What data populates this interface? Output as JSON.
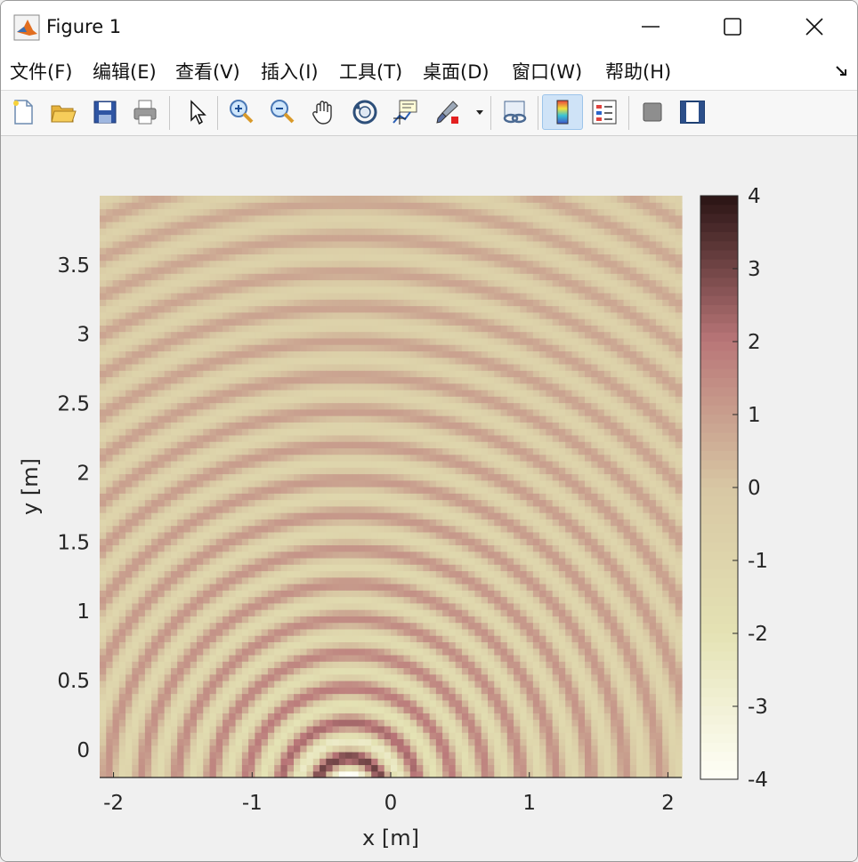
{
  "window": {
    "title": "Figure 1"
  },
  "menu": {
    "items": [
      "文件(F)",
      "编辑(E)",
      "查看(V)",
      "插入(I)",
      "工具(T)",
      "桌面(D)",
      "窗口(W)",
      "帮助(H)"
    ]
  },
  "toolbar": {
    "buttons": [
      {
        "icon": "new-figure-icon"
      },
      {
        "icon": "open-file-icon"
      },
      {
        "icon": "save-icon"
      },
      {
        "icon": "print-icon"
      },
      {
        "icon": "select-pointer-icon"
      },
      {
        "icon": "zoom-in-icon"
      },
      {
        "icon": "zoom-out-icon"
      },
      {
        "icon": "pan-hand-icon"
      },
      {
        "icon": "rotate-3d-icon"
      },
      {
        "icon": "data-cursor-icon"
      },
      {
        "icon": "brush-icon"
      },
      {
        "icon": "link-plot-icon"
      },
      {
        "icon": "colorbar-icon",
        "active": true
      },
      {
        "icon": "legend-icon"
      },
      {
        "icon": "hide-plot-tools-icon"
      },
      {
        "icon": "show-plot-tools-icon"
      }
    ]
  },
  "chart_data": {
    "type": "heatmap",
    "description_free": true,
    "xlabel": "x [m]",
    "ylabel": "y [m]",
    "xlim": [
      -2.1,
      2.1
    ],
    "ylim": [
      -0.2,
      4.0
    ],
    "xticks": [
      -2,
      -1,
      0,
      1,
      2
    ],
    "xtick_labels": [
      "-2",
      "-1",
      "0",
      "1",
      "2"
    ],
    "yticks": [
      0,
      0.5,
      1,
      1.5,
      2,
      2.5,
      3,
      3.5
    ],
    "ytick_labels": [
      "0",
      "0.5",
      "1",
      "1.5",
      "2",
      "2.5",
      "3",
      "3.5"
    ],
    "colorbar": {
      "limits": [
        -4,
        4
      ],
      "ticks": [
        4,
        3,
        2,
        1,
        0,
        -1,
        -2,
        -3,
        -4
      ],
      "tick_labels": [
        "4",
        "3",
        "2",
        "1",
        "0",
        "-1",
        "-2",
        "-3",
        "-4"
      ],
      "colormap": [
        "#fffff7",
        "#e4e2b4",
        "#d8c7a3",
        "#b97678",
        "#2a1414"
      ]
    },
    "field": {
      "kind": "circular wave pattern",
      "source_x": -0.3,
      "source_y": -0.3,
      "ring_spacing_m": 0.25,
      "peak_amplitude": 4
    }
  }
}
